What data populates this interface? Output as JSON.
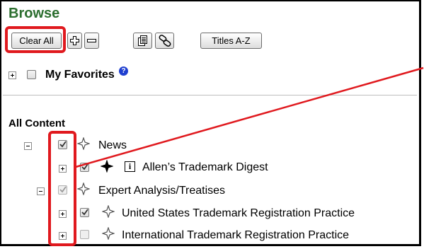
{
  "header": {
    "title": "Browse"
  },
  "toolbar": {
    "clear_all_label": "Clear All",
    "titles_label": "Titles A-Z"
  },
  "favorites": {
    "label": "My Favorites"
  },
  "all_content": {
    "label": "All Content",
    "items": [
      {
        "label": "News"
      },
      {
        "label": "Allen’s Trademark Digest"
      },
      {
        "label": "Expert Analysis/Treatises"
      },
      {
        "label": "United States Trademark Registration Practice"
      },
      {
        "label": "International Trademark Registration Practice"
      }
    ]
  },
  "colors": {
    "title_green": "#2b6e2e",
    "highlight_red": "#e0191e",
    "help_blue": "#1f3fd0"
  }
}
